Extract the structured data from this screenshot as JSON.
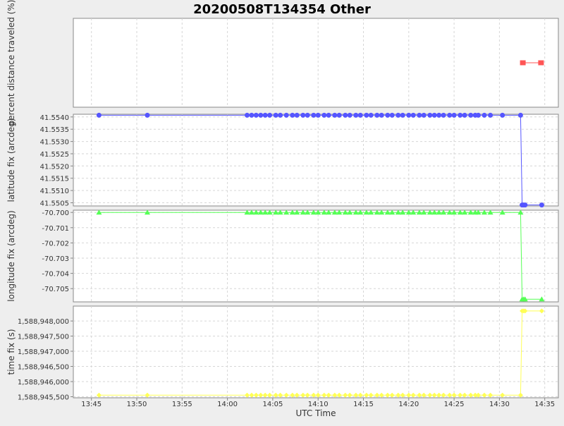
{
  "title": "20200508T134354 Other",
  "x_axis": {
    "label": "UTC Time",
    "ticks": [
      "13:45",
      "13:50",
      "13:55",
      "14:00",
      "14:05",
      "14:10",
      "14:15",
      "14:20",
      "14:25",
      "14:30",
      "14:35"
    ]
  },
  "colors": {
    "percent": "#ff5555",
    "latitude": "#5555ff",
    "longitude": "#55ff55",
    "time": "#ffff55"
  },
  "chart_data": [
    {
      "type": "line",
      "ylabel": "percent distance traveled (%)",
      "marker": "square",
      "y_ticks": [],
      "x_min": "13:43:00",
      "x_max": "14:36:30",
      "x": [
        "14:32:35",
        "14:34:35"
      ],
      "values": [
        50,
        50
      ],
      "ylim": [
        0,
        100
      ],
      "grid": true
    },
    {
      "type": "line",
      "ylabel": "latitude fix (arcdeg)",
      "marker": "circle",
      "y_ticks": [
        "41.5540",
        "41.5535",
        "41.5530",
        "41.5525",
        "41.5520",
        "41.5515",
        "41.5510",
        "41.5505"
      ],
      "x_min": "13:43:00",
      "x_max": "14:36:30",
      "x": [
        "13:45:50",
        "13:51:10",
        "14:02:10",
        "14:02:40",
        "14:03:10",
        "14:03:40",
        "14:04:10",
        "14:04:40",
        "14:05:20",
        "14:05:50",
        "14:06:30",
        "14:07:10",
        "14:07:40",
        "14:08:20",
        "14:08:50",
        "14:09:30",
        "14:10:00",
        "14:10:40",
        "14:11:10",
        "14:11:50",
        "14:12:20",
        "14:13:00",
        "14:13:30",
        "14:14:10",
        "14:14:40",
        "14:15:20",
        "14:15:50",
        "14:16:30",
        "14:17:00",
        "14:17:40",
        "14:18:10",
        "14:18:50",
        "14:19:20",
        "14:20:00",
        "14:20:30",
        "14:21:10",
        "14:21:40",
        "14:22:20",
        "14:22:50",
        "14:23:20",
        "14:23:50",
        "14:24:30",
        "14:25:00",
        "14:25:40",
        "14:26:10",
        "14:26:50",
        "14:27:20",
        "14:27:40",
        "14:28:20",
        "14:29:00",
        "14:30:20",
        "14:32:20",
        "14:32:30",
        "14:32:40",
        "14:32:50",
        "14:34:40"
      ],
      "values": [
        41.55407,
        41.55407,
        41.55407,
        41.55407,
        41.55407,
        41.55407,
        41.55407,
        41.55407,
        41.55407,
        41.55407,
        41.55407,
        41.55407,
        41.55407,
        41.55407,
        41.55407,
        41.55407,
        41.55407,
        41.55407,
        41.55407,
        41.55407,
        41.55407,
        41.55407,
        41.55407,
        41.55407,
        41.55407,
        41.55407,
        41.55407,
        41.55407,
        41.55407,
        41.55407,
        41.55407,
        41.55407,
        41.55407,
        41.55407,
        41.55407,
        41.55407,
        41.55407,
        41.55407,
        41.55407,
        41.55407,
        41.55407,
        41.55407,
        41.55407,
        41.55407,
        41.55407,
        41.55407,
        41.55407,
        41.55407,
        41.55407,
        41.55407,
        41.55407,
        41.55407,
        41.55041,
        41.55041,
        41.55041,
        41.55041
      ],
      "ylim": [
        41.55037,
        41.55411
      ],
      "grid": true
    },
    {
      "type": "line",
      "ylabel": "longitude fix (arcdeg)",
      "marker": "triangle",
      "y_ticks": [
        "-70.700",
        "-70.701",
        "-70.702",
        "-70.703",
        "-70.704",
        "-70.705"
      ],
      "x_min": "13:43:00",
      "x_max": "14:36:30",
      "x": [
        "13:45:50",
        "13:51:10",
        "14:02:10",
        "14:02:40",
        "14:03:10",
        "14:03:40",
        "14:04:10",
        "14:04:40",
        "14:05:20",
        "14:05:50",
        "14:06:30",
        "14:07:10",
        "14:07:40",
        "14:08:20",
        "14:08:50",
        "14:09:30",
        "14:10:00",
        "14:10:40",
        "14:11:10",
        "14:11:50",
        "14:12:20",
        "14:13:00",
        "14:13:30",
        "14:14:10",
        "14:14:40",
        "14:15:20",
        "14:15:50",
        "14:16:30",
        "14:17:00",
        "14:17:40",
        "14:18:10",
        "14:18:50",
        "14:19:20",
        "14:20:00",
        "14:20:30",
        "14:21:10",
        "14:21:40",
        "14:22:20",
        "14:22:50",
        "14:23:20",
        "14:23:50",
        "14:24:30",
        "14:25:00",
        "14:25:40",
        "14:26:10",
        "14:26:50",
        "14:27:20",
        "14:27:40",
        "14:28:20",
        "14:29:00",
        "14:30:20",
        "14:32:20",
        "14:32:30",
        "14:32:40",
        "14:32:50",
        "14:34:40"
      ],
      "values": [
        -70.7,
        -70.7,
        -70.7,
        -70.7,
        -70.7,
        -70.7,
        -70.7,
        -70.7,
        -70.7,
        -70.7,
        -70.7,
        -70.7,
        -70.7,
        -70.7,
        -70.7,
        -70.7,
        -70.7,
        -70.7,
        -70.7,
        -70.7,
        -70.7,
        -70.7,
        -70.7,
        -70.7,
        -70.7,
        -70.7,
        -70.7,
        -70.7,
        -70.7,
        -70.7,
        -70.7,
        -70.7,
        -70.7,
        -70.7,
        -70.7,
        -70.7,
        -70.7,
        -70.7,
        -70.7,
        -70.7,
        -70.7,
        -70.7,
        -70.7,
        -70.7,
        -70.7,
        -70.7,
        -70.7,
        -70.7,
        -70.7,
        -70.7,
        -70.7,
        -70.7,
        -70.7057,
        -70.7057,
        -70.7057,
        -70.7057
      ],
      "ylim": [
        -70.70587,
        -70.69985
      ],
      "grid": true
    },
    {
      "type": "line",
      "ylabel": "time fix (s)",
      "marker": "diamond",
      "y_ticks": [
        "1,588,948,000",
        "1,588,947,500",
        "1,588,947,000",
        "1,588,946,500",
        "1,588,946,000",
        "1,588,945,500"
      ],
      "x_min": "13:43:00",
      "x_max": "14:36:30",
      "x": [
        "13:45:50",
        "13:51:10",
        "14:02:10",
        "14:02:40",
        "14:03:10",
        "14:03:40",
        "14:04:10",
        "14:04:40",
        "14:05:20",
        "14:05:50",
        "14:06:30",
        "14:07:10",
        "14:07:40",
        "14:08:20",
        "14:08:50",
        "14:09:30",
        "14:10:00",
        "14:10:40",
        "14:11:10",
        "14:11:50",
        "14:12:20",
        "14:13:00",
        "14:13:30",
        "14:14:10",
        "14:14:40",
        "14:15:20",
        "14:15:50",
        "14:16:30",
        "14:17:00",
        "14:17:40",
        "14:18:10",
        "14:18:50",
        "14:19:20",
        "14:20:00",
        "14:20:30",
        "14:21:10",
        "14:21:40",
        "14:22:20",
        "14:22:50",
        "14:23:20",
        "14:23:50",
        "14:24:30",
        "14:25:00",
        "14:25:40",
        "14:26:10",
        "14:26:50",
        "14:27:20",
        "14:27:40",
        "14:28:20",
        "14:29:00",
        "14:30:20",
        "14:32:20",
        "14:32:30",
        "14:32:40",
        "14:32:50",
        "14:34:40"
      ],
      "values": [
        1588945550,
        1588945550,
        1588945550,
        1588945550,
        1588945550,
        1588945550,
        1588945550,
        1588945550,
        1588945550,
        1588945550,
        1588945550,
        1588945550,
        1588945550,
        1588945550,
        1588945550,
        1588945550,
        1588945550,
        1588945550,
        1588945550,
        1588945550,
        1588945550,
        1588945550,
        1588945550,
        1588945550,
        1588945550,
        1588945550,
        1588945550,
        1588945550,
        1588945550,
        1588945550,
        1588945550,
        1588945550,
        1588945550,
        1588945550,
        1588945550,
        1588945550,
        1588945550,
        1588945550,
        1588945550,
        1588945550,
        1588945550,
        1588945550,
        1588945550,
        1588945550,
        1588945550,
        1588945550,
        1588945550,
        1588945550,
        1588945550,
        1588945550,
        1588945550,
        1588945550,
        1588948330,
        1588948330,
        1588948330,
        1588948330
      ],
      "ylim": [
        1588945465,
        1588948490
      ],
      "grid": true
    }
  ]
}
